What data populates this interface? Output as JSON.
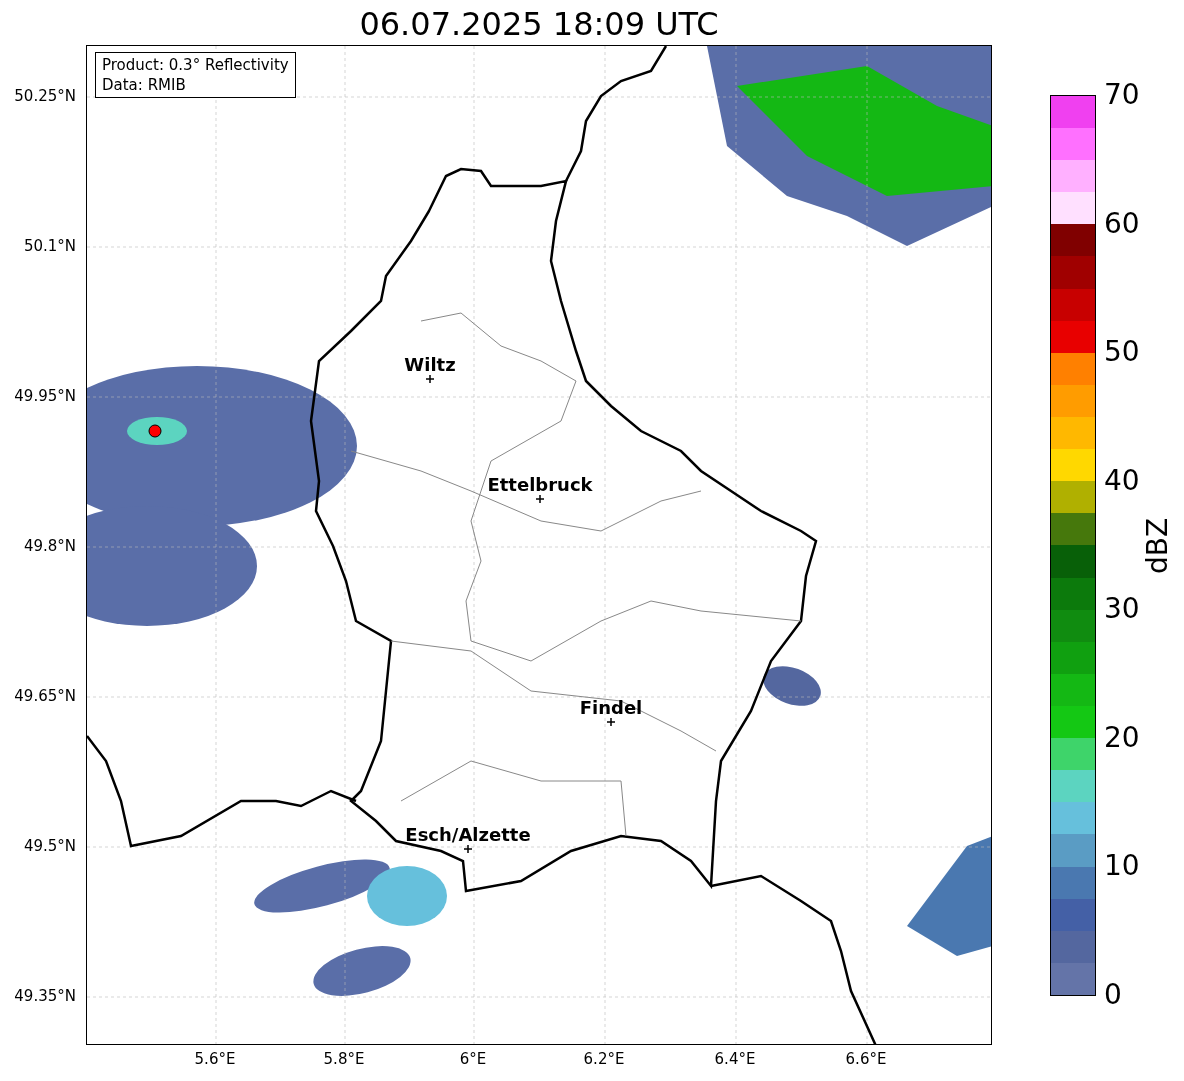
{
  "title": "06.07.2025 18:09 UTC",
  "legend": [
    "Product: 0.3° Reflectivity",
    "Data: RMIB"
  ],
  "y_ticks": [
    "50.25°N",
    "50.1°N",
    "49.95°N",
    "49.8°N",
    "49.65°N",
    "49.5°N",
    "49.35°N"
  ],
  "x_ticks": [
    "5.6°E",
    "5.8°E",
    "6°E",
    "6.2°E",
    "6.4°E",
    "6.6°E"
  ],
  "cities": [
    {
      "name": "Wiltz"
    },
    {
      "name": "Ettelbruck"
    },
    {
      "name": "Findel"
    },
    {
      "name": "Esch/Alzette"
    }
  ],
  "colorbar": {
    "label": "dBZ",
    "ticks": [
      "70",
      "60",
      "50",
      "40",
      "30",
      "20",
      "10",
      "0"
    ],
    "bins": [
      {
        "color": "#6474a8"
      },
      {
        "color": "#54679f"
      },
      {
        "color": "#4460a6"
      },
      {
        "color": "#4a78b0"
      },
      {
        "color": "#5a9cc4"
      },
      {
        "color": "#66c0dc"
      },
      {
        "color": "#5cd4c0"
      },
      {
        "color": "#3ed46a"
      },
      {
        "color": "#14c814"
      },
      {
        "color": "#14b814"
      },
      {
        "color": "#10a010"
      },
      {
        "color": "#108c10"
      },
      {
        "color": "#0c7a0c"
      },
      {
        "color": "#086008"
      },
      {
        "color": "#46780c"
      },
      {
        "color": "#b0b000"
      },
      {
        "color": "#ffd800"
      },
      {
        "color": "#ffb800"
      },
      {
        "color": "#ff9c00"
      },
      {
        "color": "#ff8000"
      },
      {
        "color": "#e80000"
      },
      {
        "color": "#c80000"
      },
      {
        "color": "#a00000"
      },
      {
        "color": "#800000"
      },
      {
        "color": "#ffe0ff"
      },
      {
        "color": "#ffb0ff"
      },
      {
        "color": "#ff70ff"
      },
      {
        "color": "#f040f0"
      }
    ]
  }
}
